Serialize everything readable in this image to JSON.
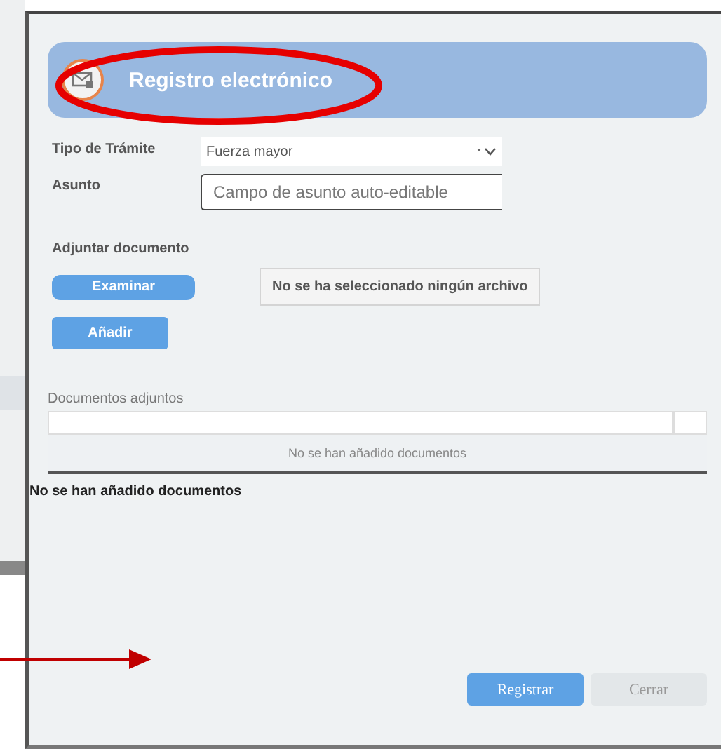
{
  "dialog": {
    "title": "Registro electrónico",
    "fields": [
      {
        "label": "Tipo de Trámite",
        "kind": "select",
        "value": "Fuerza mayor"
      },
      {
        "label": "Asunto",
        "kind": "text",
        "value": "Campo de asunto auto-editable"
      }
    ],
    "attach": {
      "heading": "Adjuntar documento",
      "browse_button": "Examinar",
      "file_status": "No se ha seleccionado ningún archivo",
      "add_button": "Añadir"
    },
    "attachments": {
      "heading": "Documentos adjuntos",
      "empty_message": "No se han añadido documentos"
    },
    "status_text": "No se han añadido documentos",
    "buttons": [
      {
        "label": "Registrar",
        "kind": "primary"
      },
      {
        "label": "Cerrar",
        "kind": "secondary"
      }
    ]
  },
  "annotations": [
    {
      "kind": "ellipse"
    },
    {
      "kind": "arrow"
    }
  ]
}
